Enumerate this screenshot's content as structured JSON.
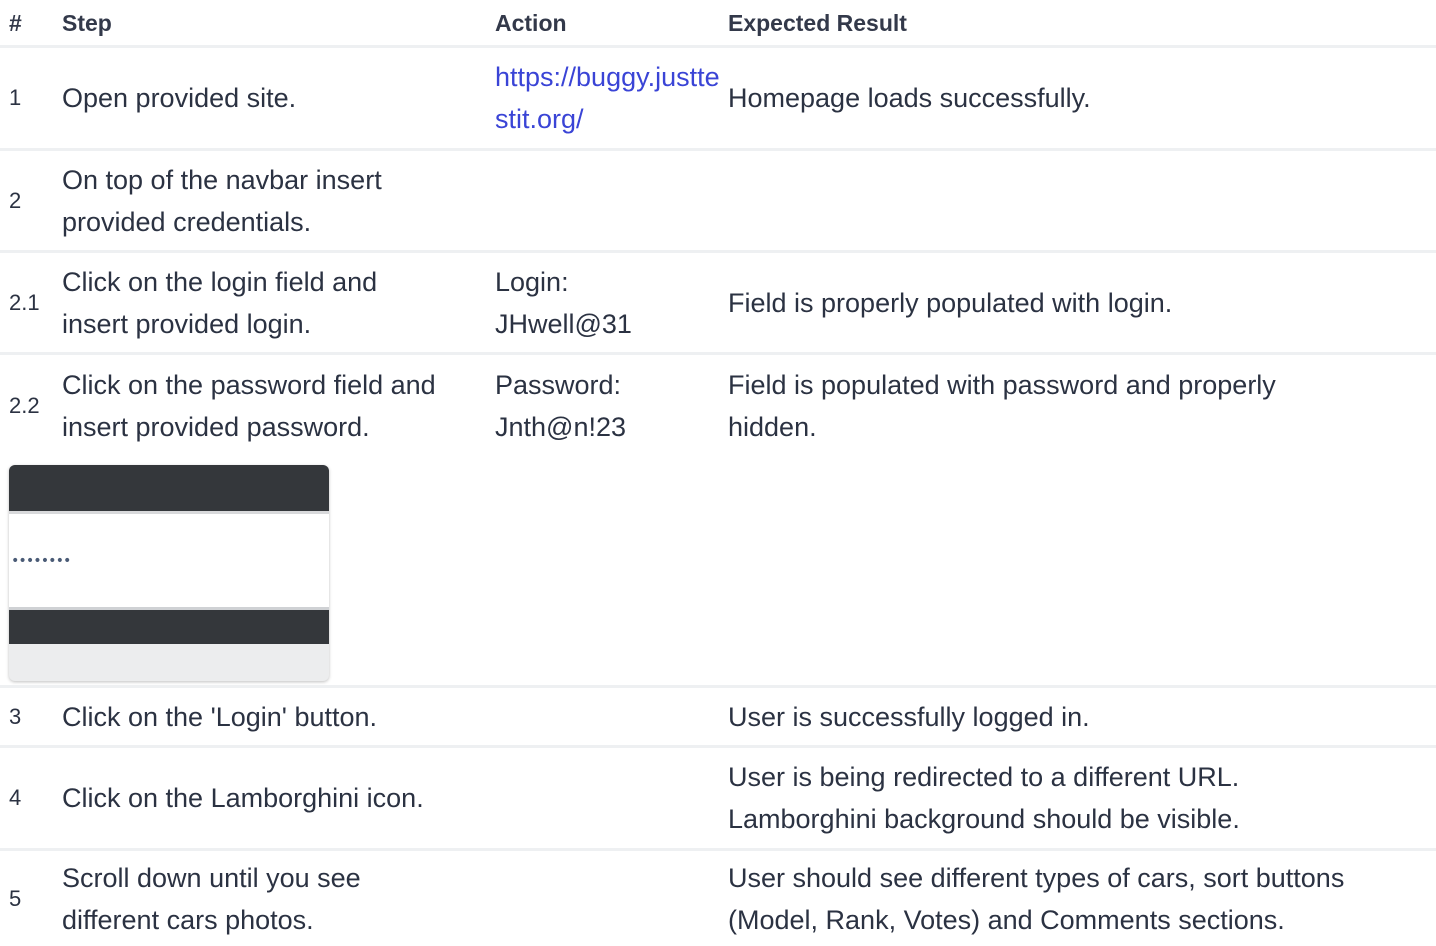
{
  "headers": {
    "num": "#",
    "step": "Step",
    "action": "Action",
    "expected": "Expected Result"
  },
  "rows": [
    {
      "num": "1",
      "step": "Open provided site.",
      "action": "https://buggy.justtestit.org/",
      "expected": "Homepage loads successfully."
    },
    {
      "num": "2",
      "step": "On top of the navbar insert provided credentials.",
      "action": "",
      "expected": ""
    },
    {
      "num": "2.1",
      "step": "Click on the login field and insert provided login.",
      "action": "Login: JHwell@31",
      "expected": "Field is properly populated with login."
    },
    {
      "num": "2.2",
      "step": "Click on the password field and insert provided password.",
      "action": "Password: Jnth@n!23",
      "expected": "Field is populated with password and properly hidden."
    },
    {
      "num": "3",
      "step": "Click on the 'Login' button.",
      "action": "",
      "expected": "User is successfully logged in."
    },
    {
      "num": "4",
      "step": "Click on the Lamborghini icon.",
      "action": "",
      "expected": "User is being redirected to a different URL. Lamborghini background should be visible."
    },
    {
      "num": "5",
      "step": "Scroll down until you see different cars photos.",
      "action": "",
      "expected": "User should see different types of cars, sort buttons (Model, Rank, Votes) and Comments sections."
    }
  ],
  "screenshot": {
    "masked_password": "••••••••"
  },
  "colors": {
    "text": "#2b3242",
    "link": "#3a44d6",
    "row_border": "#eef0f2",
    "navbar": "#34373b"
  }
}
